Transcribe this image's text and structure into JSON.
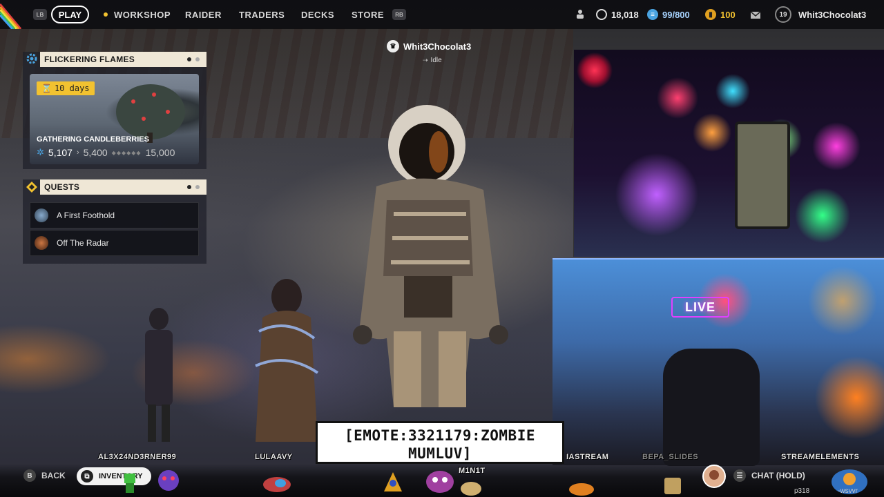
{
  "nav": {
    "lb": "LB",
    "rb": "RB",
    "play": "PLAY",
    "workshop": "WORKSHOP",
    "raider": "RAIDER",
    "traders": "TRADERS",
    "decks": "DECKS",
    "store": "STORE"
  },
  "resources": {
    "coins": "18,018",
    "capacity": "99/800",
    "tokens": "100",
    "level": "19",
    "username": "Whit3Chocolat3"
  },
  "event": {
    "title": "FLICKERING FLAMES",
    "timer": "10 days",
    "subtitle": "GATHERING CANDLEBERRIES",
    "current": "5,107",
    "next": "5,400",
    "max": "15,000"
  },
  "quests": {
    "title": "QUESTS",
    "items": [
      {
        "label": "A First Foothold"
      },
      {
        "label": "Off The Radar"
      }
    ]
  },
  "player": {
    "name": "Whit3Chocolat3",
    "status": "Idle"
  },
  "overlay": {
    "live_sign": "LIVE",
    "emote_line1": "[EMOTE:3321179:ZOMBIE",
    "emote_line2": "MUMLUV]",
    "chatters": [
      "AL3X24ND3RNER99",
      "LULAAVY",
      "M1N1T",
      "IASTREAM",
      "BEPA_SLIDES",
      "STREAMELEMENTS"
    ],
    "corner": "p318",
    "corner2": "-wsvvr"
  },
  "bottom": {
    "back_key": "B",
    "back": "BACK",
    "inventory": "INVENTORY",
    "chat": "CHAT (HOLD)"
  },
  "colors": {
    "accent_yellow": "#f2c230",
    "panel_cream": "#efe7d6",
    "capacity_blue": "#4aa3e0",
    "token_gold": "#e0a020"
  }
}
